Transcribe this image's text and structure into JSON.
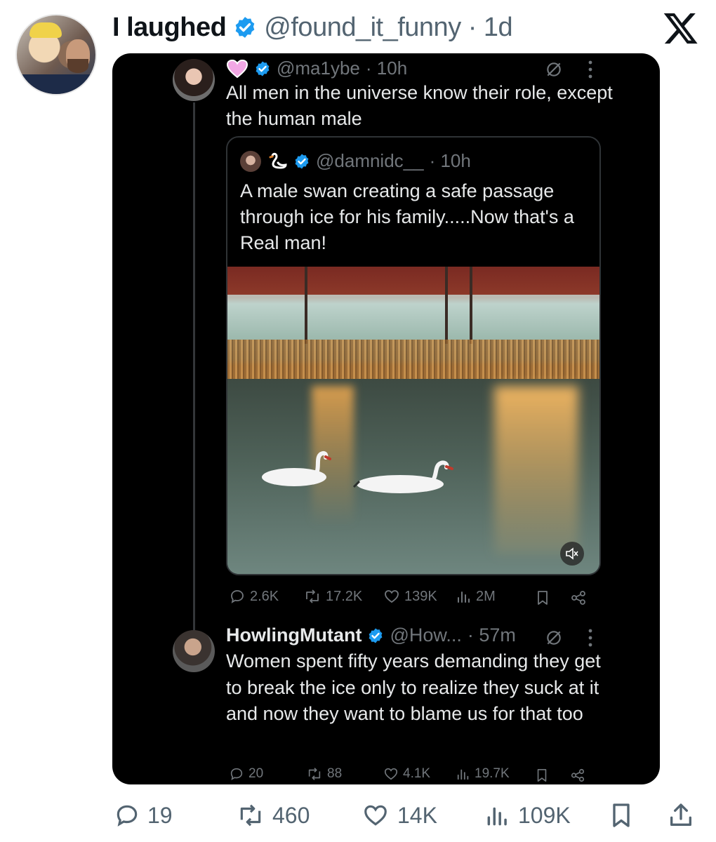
{
  "outer": {
    "name": "I laughed",
    "handle": "@found_it_funny",
    "time": "· 1d",
    "brand_icon": "x-logo"
  },
  "tweet1": {
    "handle": "@ma1ybe",
    "time": "· 10h",
    "text": "All men in the universe know their role, except the human male"
  },
  "quoted": {
    "handle": "@damnidc__",
    "time": "· 10h",
    "text": "A male swan creating a safe passage through ice for his family.....Now that's a Real man!"
  },
  "tweet1_stats": {
    "replies": "2.6K",
    "retweets": "17.2K",
    "likes": "139K",
    "views": "2M"
  },
  "tweet2": {
    "name": "HowlingMutant",
    "handle": "@How...",
    "time": "· 57m",
    "text": "Women spent fifty years demanding they get to break the ice only to realize they suck at it and now they want to blame us for that too"
  },
  "tweet2_stats": {
    "replies": "20",
    "retweets": "88",
    "likes": "4.1K",
    "views": "19.7K"
  },
  "outer_stats": {
    "replies": "19",
    "retweets": "460",
    "likes": "14K",
    "views": "109K"
  },
  "colors": {
    "verified": "#1d9bf0",
    "muted": "#536471",
    "embed_bg": "#000000"
  }
}
